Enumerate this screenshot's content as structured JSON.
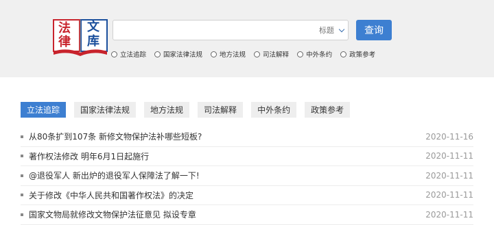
{
  "logo": {
    "chars": [
      "法",
      "文",
      "律",
      "库"
    ]
  },
  "search": {
    "placeholder": "",
    "field_label": "标题",
    "button_label": "查询"
  },
  "radios": [
    "立法追踪",
    "国家法律法规",
    "地方法规",
    "司法解释",
    "中外条约",
    "政策参考"
  ],
  "tabs": [
    {
      "label": "立法追踪",
      "active": true
    },
    {
      "label": "国家法律法规",
      "active": false
    },
    {
      "label": "地方法规",
      "active": false
    },
    {
      "label": "司法解释",
      "active": false
    },
    {
      "label": "中外条约",
      "active": false
    },
    {
      "label": "政策参考",
      "active": false
    }
  ],
  "articles": [
    {
      "title": "从80条扩到107条 新修文物保护法补哪些短板?",
      "date": "2020-11-16"
    },
    {
      "title": "著作权法修改 明年6月1日起施行",
      "date": "2020-11-11"
    },
    {
      "title": "@退役军人 新出炉的退役军人保障法了解一下!",
      "date": "2020-11-11"
    },
    {
      "title": "关于修改《中华人民共和国著作权法》的决定",
      "date": "2020-11-11"
    },
    {
      "title": "国家文物局就修改文物保护法征意见 拟设专章",
      "date": "2020-11-11"
    }
  ],
  "colors": {
    "accent": "#3d7fd1",
    "logo_red": "#c8232c",
    "logo_blue": "#1a4f9c"
  }
}
